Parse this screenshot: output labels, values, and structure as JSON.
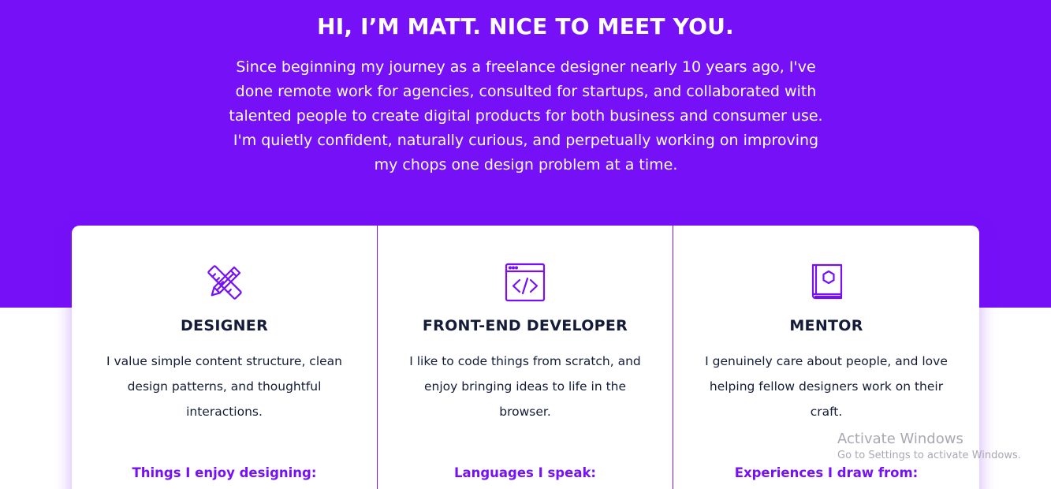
{
  "hero": {
    "title": "HI, I’M MATT. NICE TO MEET YOU.",
    "text": "Since beginning my journey as a freelance designer nearly 10 years ago, I've done remote work for agencies, consulted for startups, and collaborated with talented people to create digital products for both business and consumer use. I'm quietly confident, naturally curious, and perpetually working on improving my chops one design problem at a time."
  },
  "cards": [
    {
      "icon": "pencil-ruler-icon",
      "title": "DESIGNER",
      "description": "I value simple content structure, clean design patterns, and thoughtful interactions.",
      "subtitle": "Things I enjoy designing:"
    },
    {
      "icon": "code-window-icon",
      "title": "FRONT-END DEVELOPER",
      "description": "I like to code things from scratch, and enjoy bringing ideas to life in the browser.",
      "subtitle": "Languages I speak:"
    },
    {
      "icon": "book-icon",
      "title": "MENTOR",
      "description": "I genuinely care about people, and love helping fellow designers work on their craft.",
      "subtitle": "Experiences I draw from:"
    }
  ],
  "watermark": {
    "title": "Activate Windows",
    "subtitle": "Go to Settings to activate Windows."
  },
  "colors": {
    "accent": "#7510f7",
    "text": "#141c3a",
    "background": "#ffffff"
  }
}
